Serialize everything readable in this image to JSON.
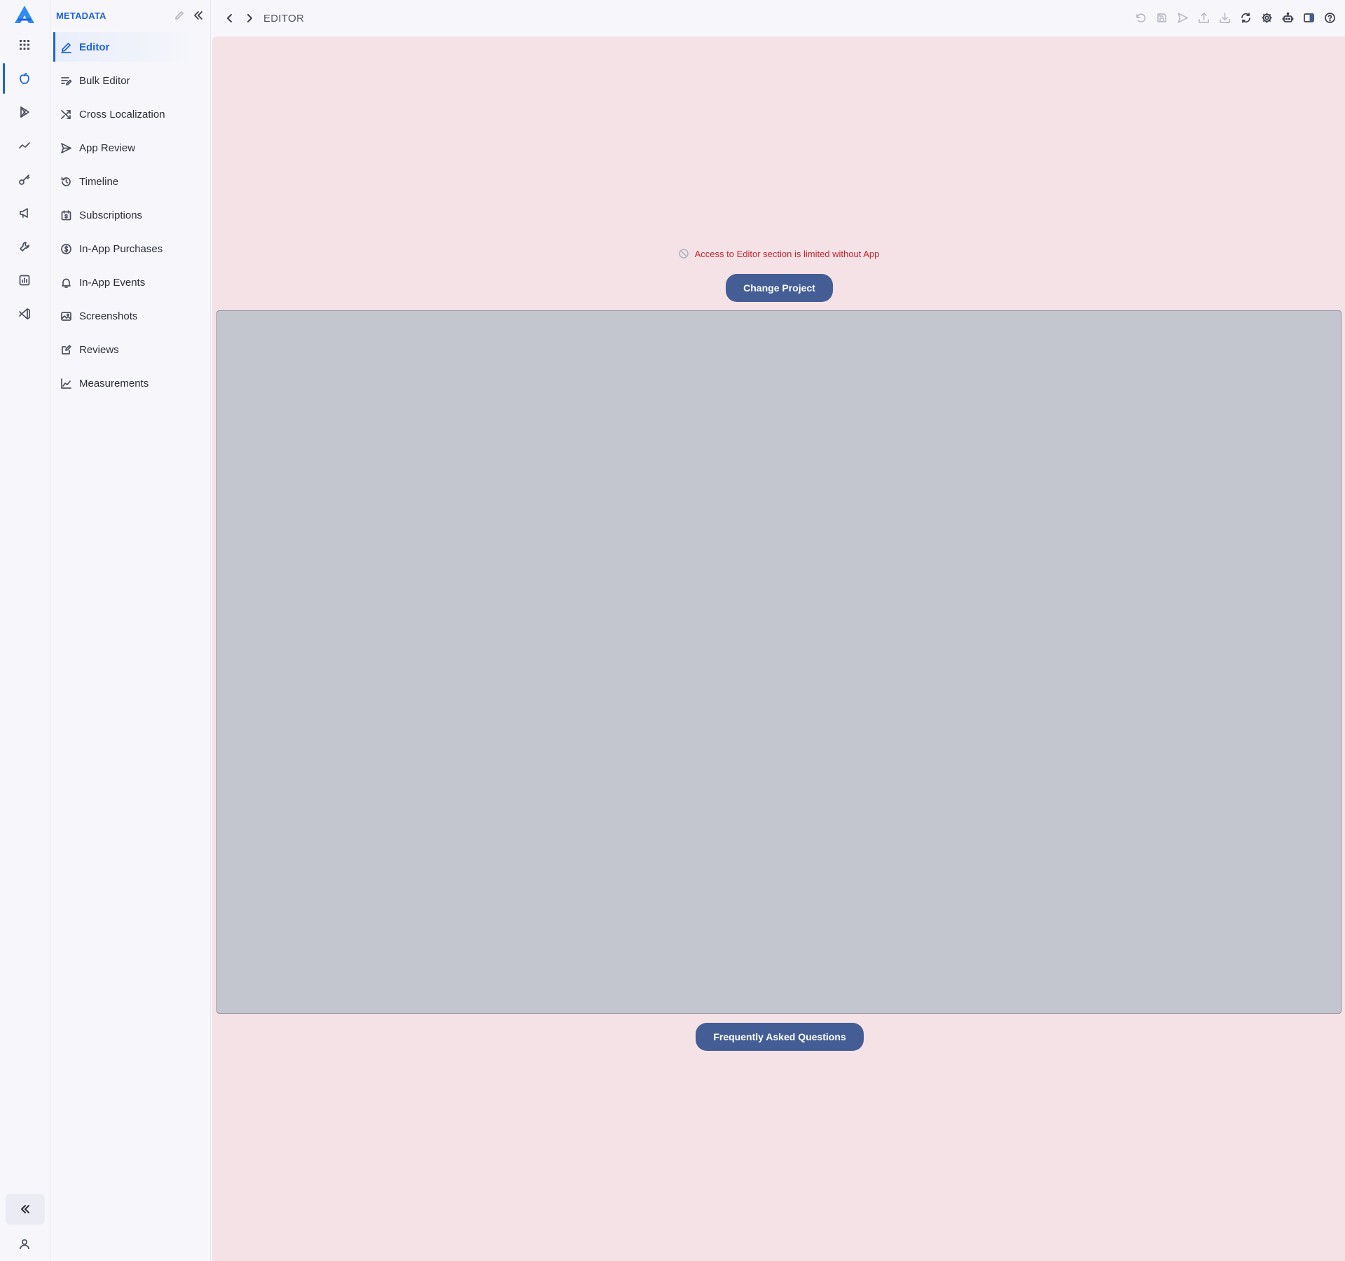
{
  "sidebar": {
    "title": "METADATA",
    "items": [
      {
        "label": "Editor"
      },
      {
        "label": "Bulk Editor"
      },
      {
        "label": "Cross Localization"
      },
      {
        "label": "App Review"
      },
      {
        "label": "Timeline"
      },
      {
        "label": "Subscriptions"
      },
      {
        "label": "In-App Purchases"
      },
      {
        "label": "In-App Events"
      },
      {
        "label": "Screenshots"
      },
      {
        "label": "Reviews"
      },
      {
        "label": "Measurements"
      }
    ],
    "active_item": "Editor"
  },
  "rail": {
    "items": [
      "apps-grid-icon",
      "apple-icon",
      "google-play-icon",
      "trend-icon",
      "key-icon",
      "megaphone-icon",
      "wrench-icon",
      "report-icon",
      "vscode-icon"
    ],
    "active_item": "apple-icon"
  },
  "topbar": {
    "breadcrumb": "EDITOR",
    "toolbar_icons": [
      "undo-icon",
      "save-icon",
      "send-icon",
      "upload-icon",
      "download-icon",
      "sync-icon",
      "settings-icon",
      "robot-icon",
      "panel-icon",
      "help-icon"
    ]
  },
  "main": {
    "notice": "Access to Editor section is limited without App",
    "change_project_label": "Change Project",
    "faq_label": "Frequently Asked Questions"
  },
  "colors": {
    "accent": "#1e63d6",
    "button": "#445e95",
    "main_bg": "#f4e2e7",
    "notice": "#c1282d",
    "video_placeholder": "#c4c6cf"
  }
}
